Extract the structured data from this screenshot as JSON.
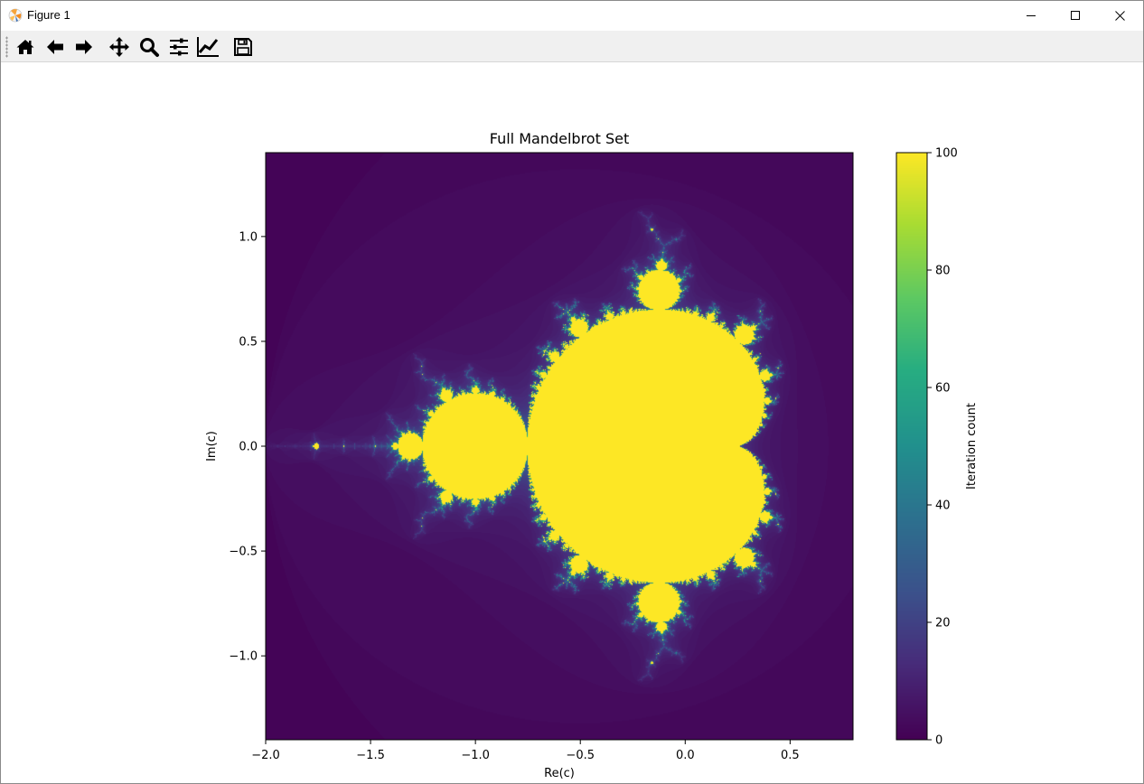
{
  "window": {
    "title": "Figure 1",
    "controls": [
      "minimize",
      "maximize",
      "close"
    ]
  },
  "toolbar": {
    "tools": [
      {
        "name": "home-icon",
        "tooltip": "Reset original view"
      },
      {
        "name": "back-icon",
        "tooltip": "Back to previous view"
      },
      {
        "name": "forward-icon",
        "tooltip": "Forward to next view"
      },
      {
        "name": "pan-icon",
        "tooltip": "Pan axes"
      },
      {
        "name": "zoom-icon",
        "tooltip": "Zoom to rectangle"
      },
      {
        "name": "subplots-icon",
        "tooltip": "Configure subplots"
      },
      {
        "name": "customize-icon",
        "tooltip": "Edit axis and curve parameters"
      },
      {
        "name": "save-icon",
        "tooltip": "Save the figure"
      }
    ]
  },
  "chart_data": {
    "type": "heatmap",
    "title": "Full Mandelbrot Set",
    "xlabel": "Re(c)",
    "ylabel": "Im(c)",
    "xlim": [
      -2.0,
      0.8
    ],
    "ylim": [
      -1.4,
      1.4
    ],
    "xticks": [
      -2.0,
      -1.5,
      -1.0,
      -0.5,
      0.0,
      0.5
    ],
    "xtick_labels": [
      "−2.0",
      "−1.5",
      "−1.0",
      "−0.5",
      "0.0",
      "0.5"
    ],
    "yticks": [
      1.0,
      0.5,
      0.0,
      -0.5,
      -1.0
    ],
    "ytick_labels": [
      "1.0",
      "0.5",
      "0.0",
      "−0.5",
      "−1.0"
    ],
    "max_iterations": 100,
    "colormap": "viridis",
    "colorbar": {
      "label": "Iteration count",
      "range": [
        0,
        100
      ],
      "ticks": [
        0,
        20,
        40,
        60,
        80,
        100
      ],
      "tick_labels": [
        "0",
        "20",
        "40",
        "60",
        "80",
        "100"
      ]
    },
    "grid": false
  }
}
